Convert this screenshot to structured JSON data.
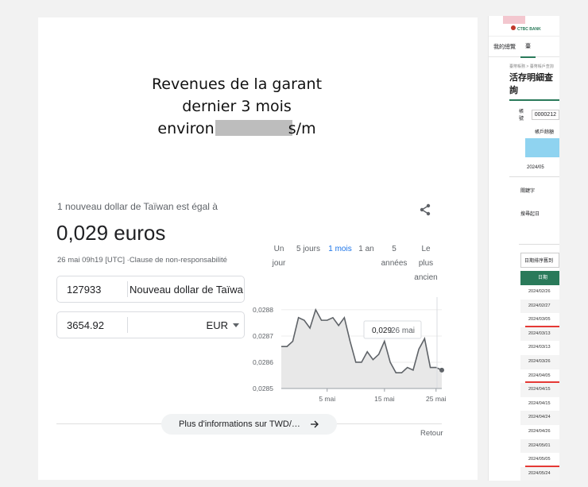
{
  "headline": {
    "line1": "Revenues de la garant",
    "line2": "dernier 3 mois",
    "line3_prefix": "environ",
    "line3_suffix": "s/m"
  },
  "converter": {
    "subtitle": "1 nouveau dollar de Taïwan est égal à",
    "rate": "0,029 euros",
    "timestamp": "26 mai 09h19 [UTC] ·Clause de non-responsabilité",
    "from_amount": "127933",
    "from_currency": "Nouveau dollar de Taïwa",
    "to_amount": "3654.92",
    "to_currency": "EUR",
    "more_button": "Plus d'informations sur TWD/…",
    "retour": "Retour",
    "ranges": [
      {
        "label": "Un\njour",
        "active": false
      },
      {
        "label": "5 jours",
        "active": false
      },
      {
        "label": "1 mois",
        "active": true
      },
      {
        "label": "1 an",
        "active": false
      },
      {
        "label": "5\nannées",
        "active": false
      },
      {
        "label": "Le\nplus\nancien",
        "active": false
      }
    ]
  },
  "chart_data": {
    "type": "area",
    "x_tick_labels": [
      "5 mai",
      "15 mai",
      "25 mai"
    ],
    "y_tick_labels": [
      "0,0288",
      "0,0287",
      "0,0286",
      "0,0285"
    ],
    "ylim": [
      0.0285,
      0.02883
    ],
    "values": [
      0.02866,
      0.02866,
      0.02868,
      0.02877,
      0.02876,
      0.02873,
      0.0288,
      0.02876,
      0.02876,
      0.02877,
      0.02874,
      0.02877,
      0.02868,
      0.0286,
      0.0286,
      0.02864,
      0.02861,
      0.02863,
      0.02868,
      0.0286,
      0.02856,
      0.02856,
      0.02858,
      0.02857,
      0.02865,
      0.02869,
      0.02858,
      0.02858,
      0.02857
    ],
    "tooltip": {
      "value": "0,029",
      "date": "26 mai"
    },
    "line_color": "#5f6368",
    "fill_color": "#e8e8e8"
  },
  "bank": {
    "logo": "CTBC BANK",
    "tabs": [
      "我的總覽",
      "臺"
    ],
    "breadcrumb": "臺幣帳務 > 臺幣帳戶查詢",
    "title": "活存明細查詢",
    "account_label": "帳號",
    "account_value": "0000212",
    "account_name_label": "帳戶餘額",
    "period": "2024/05",
    "keyword_label": "關鍵字",
    "query_start_label": "搜尋起日",
    "sort_label": "日期排序舊到",
    "table_header": "日期",
    "rows": [
      {
        "date": "2024/02/26",
        "mark": false
      },
      {
        "date": "2024/02/27",
        "mark": false
      },
      {
        "date": "2024/03/05",
        "mark": true
      },
      {
        "date": "2024/03/13",
        "mark": false
      },
      {
        "date": "2024/03/13",
        "mark": false
      },
      {
        "date": "2024/03/26",
        "mark": false
      },
      {
        "date": "2024/04/05",
        "mark": true
      },
      {
        "date": "2024/04/15",
        "mark": false
      },
      {
        "date": "2024/04/15",
        "mark": false
      },
      {
        "date": "2024/04/24",
        "mark": false
      },
      {
        "date": "2024/04/26",
        "mark": false
      },
      {
        "date": "2024/05/01",
        "mark": false
      },
      {
        "date": "2024/05/05",
        "mark": true
      },
      {
        "date": "2024/05/24",
        "mark": false
      }
    ]
  }
}
